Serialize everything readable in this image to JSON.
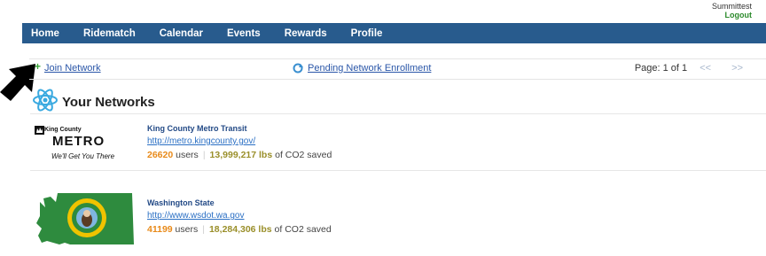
{
  "user": {
    "name": "Summittest",
    "logout_label": "Logout"
  },
  "nav": {
    "items": [
      "Home",
      "Ridematch",
      "Calendar",
      "Events",
      "Rewards",
      "Profile"
    ]
  },
  "toolbar": {
    "join_label": "Join Network",
    "pending_label": "Pending Network Enrollment",
    "page_label": "Page: 1 of 1",
    "prev_label": "<<",
    "next_label": ">>"
  },
  "section": {
    "title": "Your Networks"
  },
  "networks": [
    {
      "name": "King County Metro Transit",
      "url": "http://metro.kingcounty.gov/",
      "users": "26620",
      "users_label": "users",
      "co2": "13,999,217 lbs",
      "co2_label": "of CO2 saved",
      "logo": {
        "org": "King County",
        "wordmark": "METRO",
        "tagline": "We'll Get You There"
      }
    },
    {
      "name": "Washington State",
      "url": "http://www.wsdot.wa.gov",
      "users": "41199",
      "users_label": "users",
      "co2": "18,284,306 lbs",
      "co2_label": "of CO2 saved"
    }
  ],
  "colors": {
    "nav_bg": "#285b8d",
    "link": "#2a56a8",
    "users": "#e88a1a",
    "co2": "#9a8f2a",
    "wa_green": "#2e8b3e"
  },
  "icons": [
    "cursor-arrow-icon",
    "plus-icon",
    "refresh-icon",
    "network-icon",
    "metro-logo",
    "washington-state-logo"
  ]
}
